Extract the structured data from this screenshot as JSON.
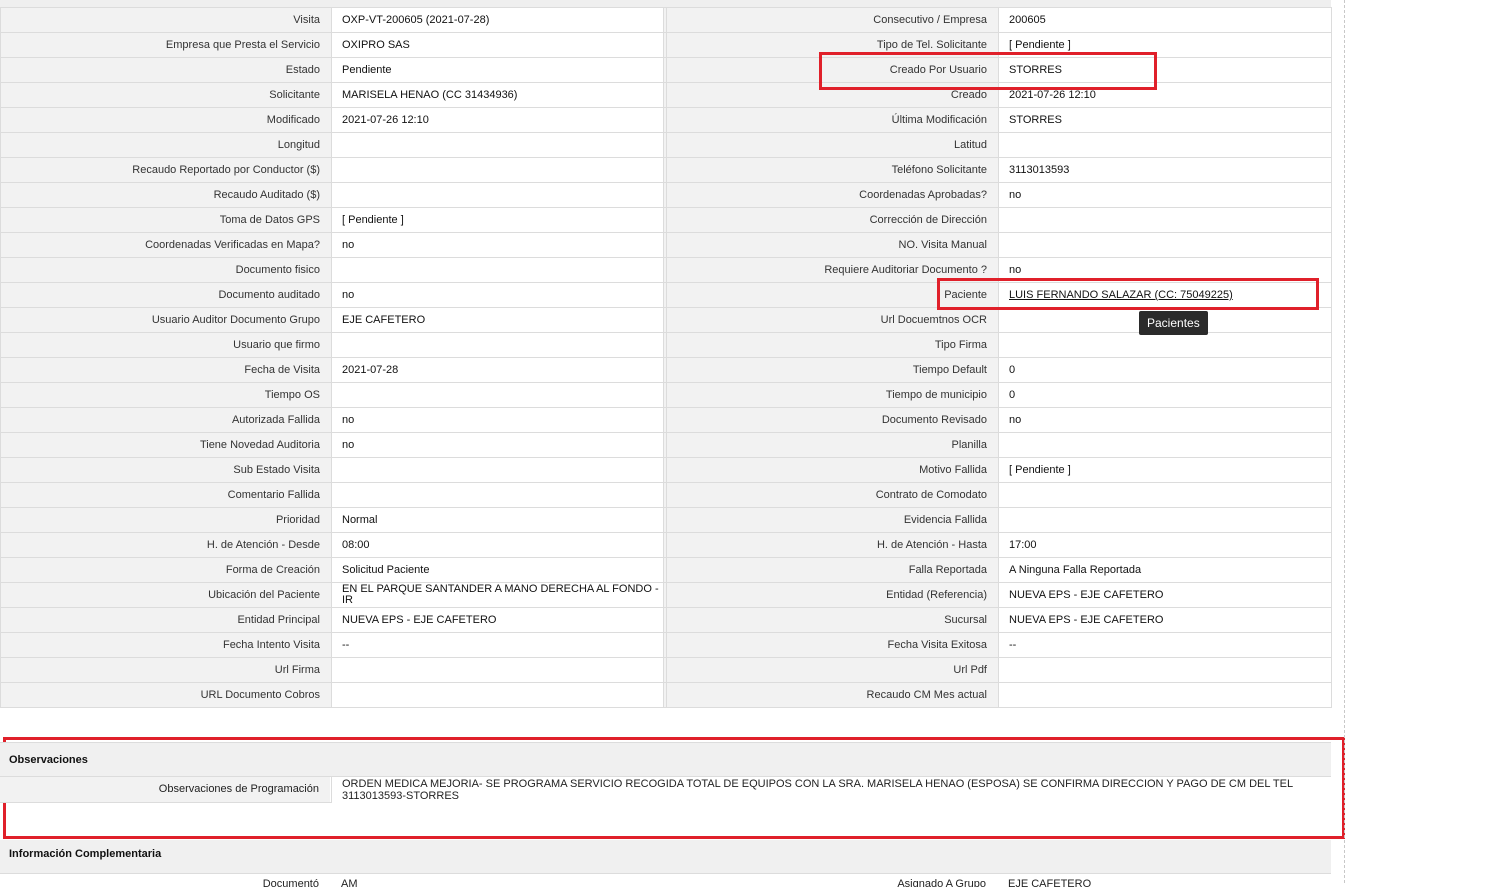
{
  "rows": [
    {
      "l1": "Visita",
      "v1": "OXP-VT-200605 (2021-07-28)",
      "l2": "Consecutivo / Empresa",
      "v2": "200605"
    },
    {
      "l1": "Empresa que Presta el Servicio",
      "v1": "OXIPRO SAS",
      "l2": "Tipo de Tel. Solicitante",
      "v2": "[ Pendiente ]"
    },
    {
      "l1": "Estado",
      "v1": "Pendiente",
      "l2": "Creado Por Usuario",
      "v2": "STORRES"
    },
    {
      "l1": "Solicitante",
      "v1": "MARISELA HENAO (CC 31434936)",
      "l2": "Creado",
      "v2": "2021-07-26 12:10"
    },
    {
      "l1": "Modificado",
      "v1": "2021-07-26 12:10",
      "l2": "Última Modificación",
      "v2": " STORRES"
    },
    {
      "l1": "Longitud",
      "v1": "",
      "l2": "Latitud",
      "v2": ""
    },
    {
      "l1": "Recaudo Reportado por Conductor ($)",
      "v1": "",
      "l2": "Teléfono Solicitante",
      "v2": "3113013593"
    },
    {
      "l1": "Recaudo Auditado ($)",
      "v1": "",
      "l2": "Coordenadas Aprobadas?",
      "v2": " no"
    },
    {
      "l1": "Toma de Datos GPS",
      "v1": "[ Pendiente ]",
      "l2": "Corrección de Dirección",
      "v2": ""
    },
    {
      "l1": "Coordenadas Verificadas en Mapa?",
      "v1": " no",
      "l2": "NO. Visita Manual",
      "v2": ""
    },
    {
      "l1": "Documento fisico",
      "v1": "",
      "l2": "Requiere Auditoriar Documento ?",
      "v2": " no"
    },
    {
      "l1": "Documento auditado",
      "v1": " no",
      "l2": "Paciente",
      "v2": "LUIS FERNANDO SALAZAR (CC: 75049225)",
      "link": true
    },
    {
      "l1": "Usuario Auditor Documento Grupo",
      "v1": "EJE CAFETERO",
      "l2": "Url Docuemtnos OCR",
      "v2": ""
    },
    {
      "l1": "Usuario que firmo",
      "v1": "",
      "l2": "Tipo Firma",
      "v2": ""
    },
    {
      "l1": "Fecha de Visita",
      "v1": " 2021-07-28",
      "l2": "Tiempo Default",
      "v2": "0"
    },
    {
      "l1": "Tiempo OS",
      "v1": "",
      "l2": "Tiempo de municipio",
      "v2": "0"
    },
    {
      "l1": "Autorizada Fallida",
      "v1": " no",
      "l2": "Documento Revisado",
      "v2": " no"
    },
    {
      "l1": "Tiene Novedad Auditoria",
      "v1": " no",
      "l2": "Planilla",
      "v2": ""
    },
    {
      "l1": "Sub Estado Visita",
      "v1": "",
      "l2": "Motivo Fallida",
      "v2": "[ Pendiente ]"
    },
    {
      "l1": "Comentario Fallida",
      "v1": "",
      "l2": "Contrato de Comodato",
      "v2": ""
    },
    {
      "l1": "Prioridad",
      "v1": "Normal",
      "l2": "Evidencia Fallida",
      "v2": ""
    },
    {
      "l1": "H. de Atención - Desde",
      "v1": "08:00",
      "l2": "H. de Atención - Hasta",
      "v2": "17:00"
    },
    {
      "l1": "Forma de Creación",
      "v1": "Solicitud Paciente",
      "l2": "Falla Reportada",
      "v2": "A Ninguna Falla Reportada"
    },
    {
      "l1": "Ubicación del Paciente",
      "v1": "EN EL PARQUE SANTANDER A MANO DERECHA AL FONDO - IR",
      "l2": "Entidad (Referencia)",
      "v2": "NUEVA EPS - EJE CAFETERO"
    },
    {
      "l1": "Entidad Principal",
      "v1": "NUEVA EPS - EJE CAFETERO",
      "l2": "Sucursal",
      "v2": "NUEVA EPS - EJE CAFETERO"
    },
    {
      "l1": "Fecha Intento Visita",
      "v1": " --",
      "l2": "Fecha Visita Exitosa",
      "v2": " --"
    },
    {
      "l1": "Url Firma",
      "v1": "",
      "l2": "Url Pdf",
      "v2": ""
    },
    {
      "l1": "URL Documento Cobros",
      "v1": "",
      "l2": "Recaudo CM Mes actual",
      "v2": ""
    }
  ],
  "tooltip": "Pacientes",
  "observaciones": {
    "title": "Observaciones",
    "label": "Observaciones de Programación",
    "value": "  ORDEN MEDICA MEJORIA- SE PROGRAMA SERVICIO RECOGIDA TOTAL DE EQUIPOS CON LA SRA. MARISELA HENAO (ESPOSA) SE CONFIRMA DIRECCION Y PAGO DE CM DEL TEL 3113013593-STORRES"
  },
  "info_complementaria": {
    "title": "Información Complementaria",
    "partial_row": {
      "l1": "Documentó",
      "v1": "AM",
      "l2": "Asignado A Grupo",
      "v2": "EJE CAFETERO"
    }
  },
  "colors": {
    "highlight": "#e0202a",
    "label_bg": "#f2f2f2",
    "tooltip_bg": "#2b2b2b"
  }
}
